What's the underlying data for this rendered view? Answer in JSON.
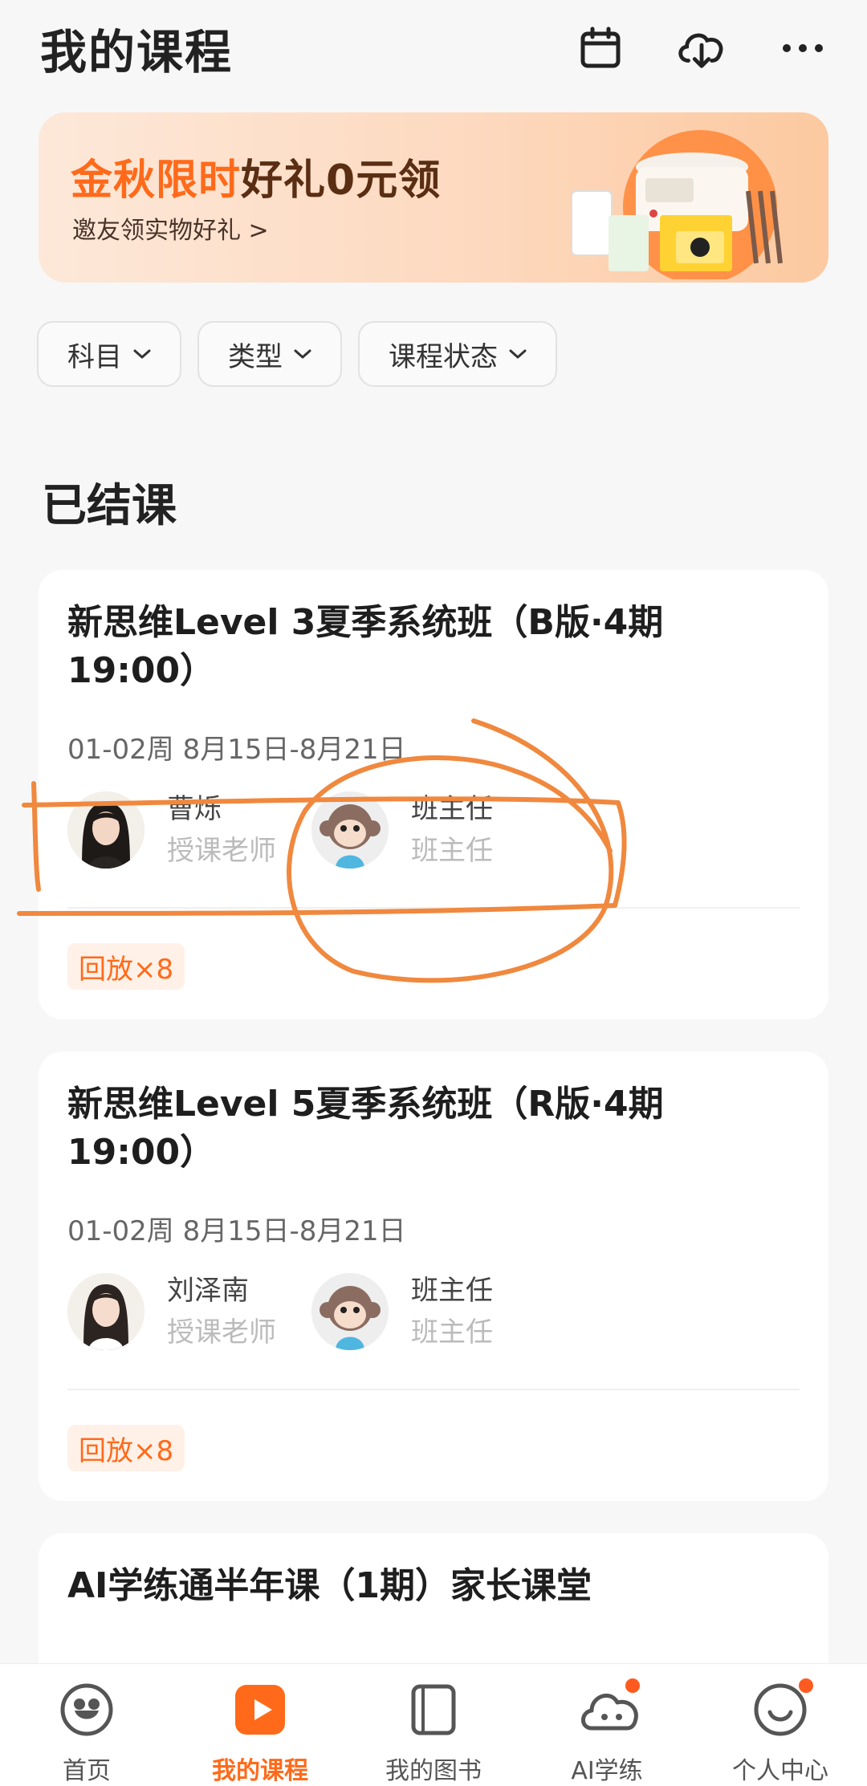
{
  "header": {
    "title": "我的课程",
    "icons": [
      "calendar-icon",
      "cloud-download-icon",
      "more-icon"
    ]
  },
  "promo": {
    "title_highlight": "金秋限时",
    "title_rest": "好礼0元领",
    "subtitle": "邀友领实物好礼 >"
  },
  "filters": [
    {
      "label": "科目"
    },
    {
      "label": "类型"
    },
    {
      "label": "课程状态"
    }
  ],
  "section": {
    "title": "已结课"
  },
  "courses": [
    {
      "title": "新思维Level 3夏季系统班（B版·4期 19:00）",
      "dates": "01-02周 8月15日-8月21日",
      "teacher": {
        "name": "曹烁",
        "role": "授课老师"
      },
      "head_teacher": {
        "name": "班主任",
        "role": "班主任"
      },
      "badge": "回放×8"
    },
    {
      "title": "新思维Level 5夏季系统班（R版·4期 19:00）",
      "dates": "01-02周 8月15日-8月21日",
      "teacher": {
        "name": "刘泽南",
        "role": "授课老师"
      },
      "head_teacher": {
        "name": "班主任",
        "role": "班主任"
      },
      "badge": "回放×8"
    },
    {
      "title": "AI学练通半年课（1期）家长课堂"
    }
  ],
  "tabbar": {
    "items": [
      {
        "label": "首页",
        "icon": "home-icon"
      },
      {
        "label": "我的课程",
        "icon": "play-icon"
      },
      {
        "label": "我的图书",
        "icon": "book-icon"
      },
      {
        "label": "AI学练",
        "icon": "ai-cloud-icon"
      },
      {
        "label": "个人中心",
        "icon": "smile-icon"
      }
    ],
    "active": 1
  },
  "colors": {
    "accent": "#ff6a1a",
    "annotation": "#f0883e",
    "background": "#f7f7f7"
  }
}
